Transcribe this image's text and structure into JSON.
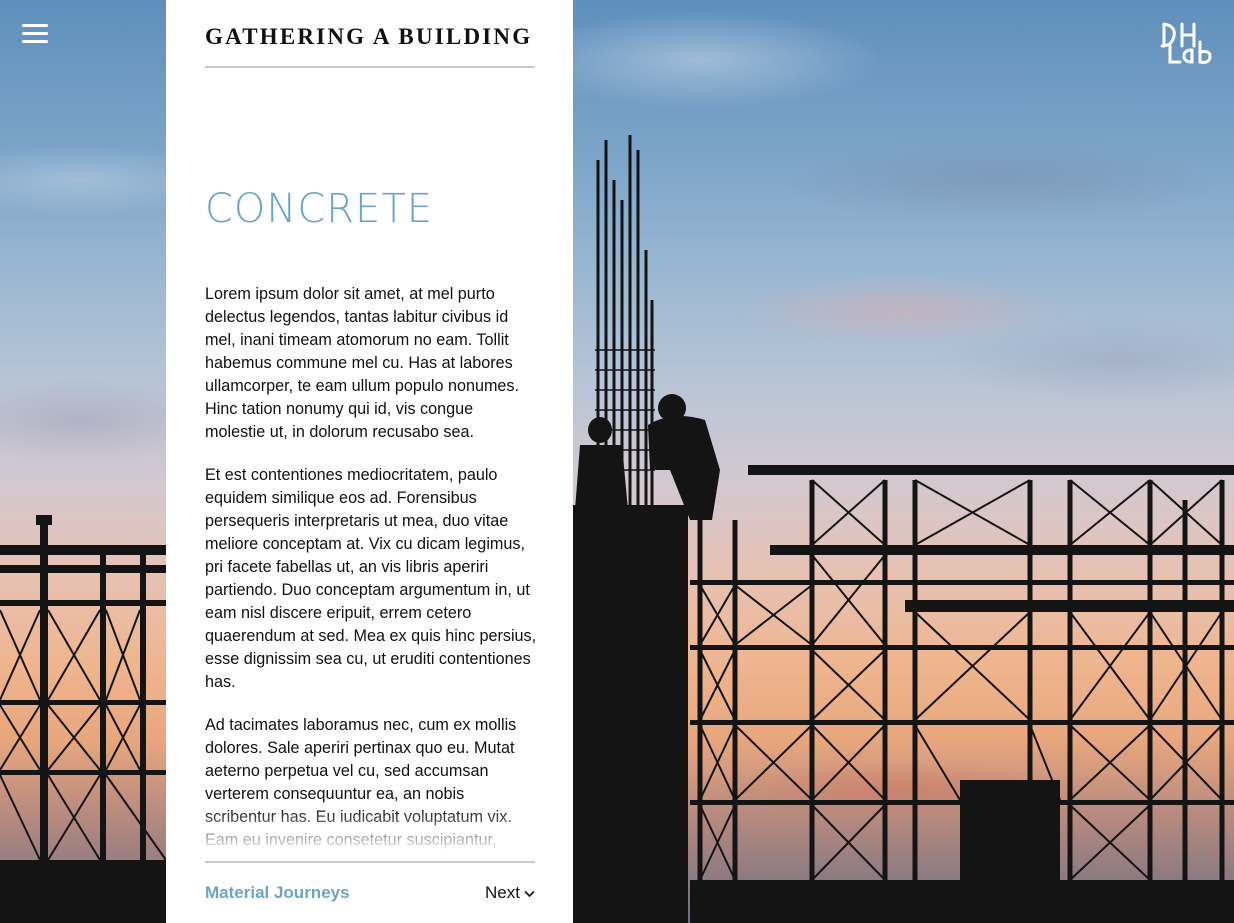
{
  "header": {
    "site_title": "GATHERING A BUILDING",
    "menu_icon": "hamburger-menu-icon",
    "logo_text": "DH Lab"
  },
  "article": {
    "heading": "CONCRETE",
    "paragraphs": [
      "Lorem ipsum dolor sit amet, at mel purto delectus legendos, tantas labitur civibus id mel, inani timeam atomorum no eam. Tollit habemus commune mel cu. Has at labores ullamcorper, te eam ullum populo nonumes. Hinc tation nonumy qui id, vis congue molestie ut, in dolorum recusabo sea.",
      "Et est contentiones mediocritatem, paulo equidem similique eos ad. Forensibus persequeris interpretaris ut mea, duo vitae meliore conceptam at. Vix cu dicam legimus, pri facete fabellas ut, an vis libris aperiri partiendo. Duo conceptam argumentum in, ut eam nisl discere eripuit, errem cetero quaerendum at sed. Mea ex quis hinc persius, esse dignissim sea cu, ut eruditi contentiones has.",
      "Ad tacimates laboramus nec, cum ex mollis dolores. Sale aperiri pertinax quo eu. Mutat aeterno perpetua vel cu, sed accumsan verterem consequuntur ea, an nobis scribentur has. Eu iudicabit voluptatum vix. Eam eu invenire consetetur suscipiantur,"
    ]
  },
  "footer": {
    "journey_link": "Material Journeys",
    "next_label": "Next",
    "next_icon": "chevron-down-icon"
  },
  "colors": {
    "accent": "#6aa5c8",
    "panel_bg": "#ffffff",
    "text": "#111111",
    "rule": "#c9c9c9"
  }
}
